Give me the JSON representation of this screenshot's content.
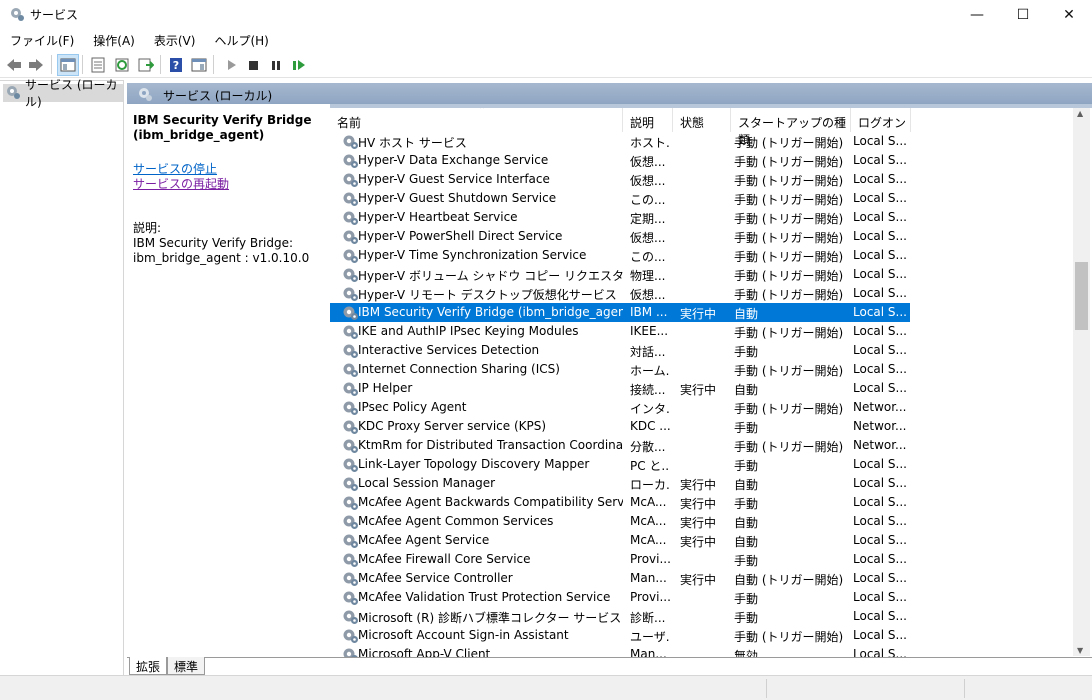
{
  "window": {
    "title": "サービス"
  },
  "menu": [
    "ファイル(F)",
    "操作(A)",
    "表示(V)",
    "ヘルプ(H)"
  ],
  "tree": {
    "item": "サービス (ローカル)"
  },
  "pane": {
    "header": "サービス (ローカル)"
  },
  "details": {
    "service_title": "IBM Security Verify Bridge (ibm_bridge_agent)",
    "stop_link": "サービスの停止",
    "restart_link": "サービスの再起動",
    "desc_label": "説明:",
    "desc_text": "IBM Security Verify Bridge: ibm_bridge_agent : v1.0.10.0"
  },
  "columns": {
    "name": "名前",
    "desc": "説明",
    "status": "状態",
    "startup": "スタートアップの種類",
    "logon": "ログオン"
  },
  "rows": [
    {
      "name": "HV ホスト サービス",
      "desc": "ホスト...",
      "status": "",
      "startup": "手動 (トリガー開始)",
      "logon": "Local S..."
    },
    {
      "name": "Hyper-V Data Exchange Service",
      "desc": "仮想...",
      "status": "",
      "startup": "手動 (トリガー開始)",
      "logon": "Local S..."
    },
    {
      "name": "Hyper-V Guest Service Interface",
      "desc": "仮想...",
      "status": "",
      "startup": "手動 (トリガー開始)",
      "logon": "Local S..."
    },
    {
      "name": "Hyper-V Guest Shutdown Service",
      "desc": "この...",
      "status": "",
      "startup": "手動 (トリガー開始)",
      "logon": "Local S..."
    },
    {
      "name": "Hyper-V Heartbeat Service",
      "desc": "定期...",
      "status": "",
      "startup": "手動 (トリガー開始)",
      "logon": "Local S..."
    },
    {
      "name": "Hyper-V PowerShell Direct Service",
      "desc": "仮想...",
      "status": "",
      "startup": "手動 (トリガー開始)",
      "logon": "Local S..."
    },
    {
      "name": "Hyper-V Time Synchronization Service",
      "desc": "この...",
      "status": "",
      "startup": "手動 (トリガー開始)",
      "logon": "Local S..."
    },
    {
      "name": "Hyper-V ボリューム シャドウ コピー リクエスター",
      "desc": "物理...",
      "status": "",
      "startup": "手動 (トリガー開始)",
      "logon": "Local S..."
    },
    {
      "name": "Hyper-V リモート デスクトップ仮想化サービス",
      "desc": "仮想...",
      "status": "",
      "startup": "手動 (トリガー開始)",
      "logon": "Local S..."
    },
    {
      "name": "IBM Security Verify Bridge (ibm_bridge_agent)",
      "desc": "IBM ...",
      "status": "実行中",
      "startup": "自動",
      "logon": "Local S...",
      "selected": true
    },
    {
      "name": "IKE and AuthIP IPsec Keying Modules",
      "desc": "IKEE...",
      "status": "",
      "startup": "手動 (トリガー開始)",
      "logon": "Local S..."
    },
    {
      "name": "Interactive Services Detection",
      "desc": "対話...",
      "status": "",
      "startup": "手動",
      "logon": "Local S..."
    },
    {
      "name": "Internet Connection Sharing (ICS)",
      "desc": "ホーム...",
      "status": "",
      "startup": "手動 (トリガー開始)",
      "logon": "Local S..."
    },
    {
      "name": "IP Helper",
      "desc": "接続...",
      "status": "実行中",
      "startup": "自動",
      "logon": "Local S..."
    },
    {
      "name": "IPsec Policy Agent",
      "desc": "インタ...",
      "status": "",
      "startup": "手動 (トリガー開始)",
      "logon": "Networ..."
    },
    {
      "name": "KDC Proxy Server service (KPS)",
      "desc": "KDC ...",
      "status": "",
      "startup": "手動",
      "logon": "Networ..."
    },
    {
      "name": "KtmRm for Distributed Transaction Coordinator",
      "desc": "分散...",
      "status": "",
      "startup": "手動 (トリガー開始)",
      "logon": "Networ..."
    },
    {
      "name": "Link-Layer Topology Discovery Mapper",
      "desc": "PC と...",
      "status": "",
      "startup": "手動",
      "logon": "Local S..."
    },
    {
      "name": "Local Session Manager",
      "desc": "ローカ...",
      "status": "実行中",
      "startup": "自動",
      "logon": "Local S..."
    },
    {
      "name": "McAfee Agent Backwards Compatibility Service",
      "desc": "McA...",
      "status": "実行中",
      "startup": "手動",
      "logon": "Local S..."
    },
    {
      "name": "McAfee Agent Common Services",
      "desc": "McA...",
      "status": "実行中",
      "startup": "自動",
      "logon": "Local S..."
    },
    {
      "name": "McAfee Agent Service",
      "desc": "McA...",
      "status": "実行中",
      "startup": "自動",
      "logon": "Local S..."
    },
    {
      "name": "McAfee Firewall Core Service",
      "desc": "Provi...",
      "status": "",
      "startup": "手動",
      "logon": "Local S..."
    },
    {
      "name": "McAfee Service Controller",
      "desc": "Man...",
      "status": "実行中",
      "startup": "自動 (トリガー開始)",
      "logon": "Local S..."
    },
    {
      "name": "McAfee Validation Trust Protection Service",
      "desc": "Provi...",
      "status": "",
      "startup": "手動",
      "logon": "Local S..."
    },
    {
      "name": "Microsoft (R) 診断ハブ標準コレクター サービス",
      "desc": "診断...",
      "status": "",
      "startup": "手動",
      "logon": "Local S..."
    },
    {
      "name": "Microsoft Account Sign-in Assistant",
      "desc": "ユーザ...",
      "status": "",
      "startup": "手動 (トリガー開始)",
      "logon": "Local S..."
    },
    {
      "name": "Microsoft App-V Client",
      "desc": "Man...",
      "status": "",
      "startup": "無効",
      "logon": "Local S..."
    }
  ],
  "tabs": [
    "拡張",
    "標準"
  ],
  "colors": {
    "selection": "#0078d7",
    "header": "#8ea5c2"
  }
}
